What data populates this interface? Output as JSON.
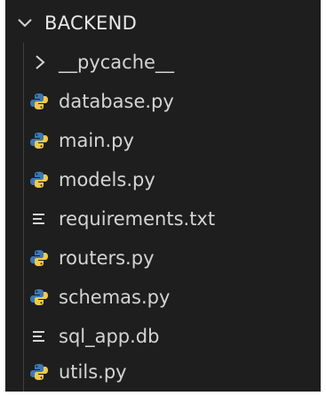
{
  "explorer": {
    "folder": {
      "label": "BACKEND",
      "expanded": true,
      "icon": "chevron-down-icon"
    },
    "items": [
      {
        "label": "__pycache__",
        "type": "folder",
        "icon": "chevron-right-icon"
      },
      {
        "label": "database.py",
        "type": "python",
        "icon": "python-icon"
      },
      {
        "label": "main.py",
        "type": "python",
        "icon": "python-icon"
      },
      {
        "label": "models.py",
        "type": "python",
        "icon": "python-icon"
      },
      {
        "label": "requirements.txt",
        "type": "text",
        "icon": "text-file-icon"
      },
      {
        "label": "routers.py",
        "type": "python",
        "icon": "python-icon"
      },
      {
        "label": "schemas.py",
        "type": "python",
        "icon": "python-icon"
      },
      {
        "label": "sql_app.db",
        "type": "text",
        "icon": "text-file-icon"
      },
      {
        "label": "utils.py",
        "type": "python",
        "icon": "python-icon"
      }
    ],
    "colors": {
      "background": "#1e1e1e",
      "text": "#d4d4d4",
      "python_blue": "#3c79b6",
      "python_yellow": "#f2c94c"
    }
  }
}
